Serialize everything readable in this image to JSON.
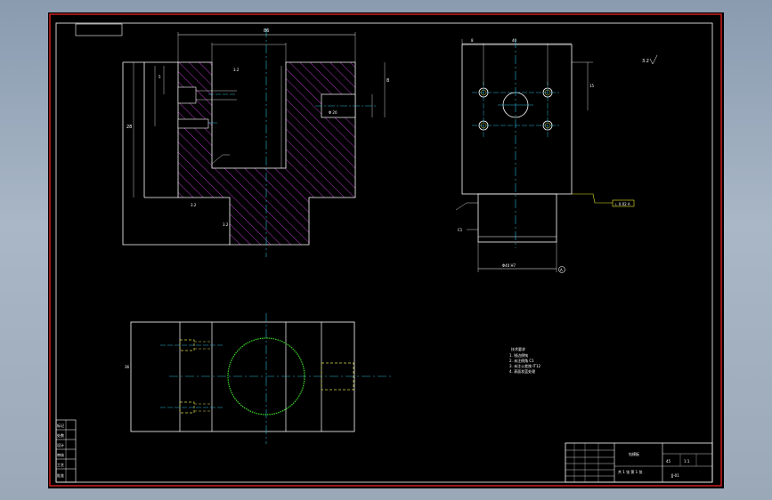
{
  "colors": {
    "background": "#000000",
    "border_red": "#cc1f1f",
    "outline": "#ffffff",
    "centerline": "#2ab7d6",
    "hatch": "#b234c4",
    "circle_green": "#3ddc2a",
    "leader_yellow": "#e6e62a",
    "hidden_line": "#d8d84a"
  },
  "front_view": {
    "dim_top": "86",
    "dim_left": "28",
    "dim_right": "8",
    "dim_inner": "5",
    "bore_note": "Φ 20",
    "roughness_a": "3.2",
    "roughness_b": "3.2",
    "roughness_c": "3.2"
  },
  "side_view": {
    "dim_top_left": "8",
    "dim_top_center": "40",
    "dim_right": "15",
    "roughness": "3.2",
    "tolerance_frame": "⊥ 0.02 A",
    "dim_bottom": "Φ40 H7",
    "datum": "A",
    "chamfer": "C1"
  },
  "top_view": {
    "dim_left": "36"
  },
  "general_roughness": "3.2",
  "notes": [
    "技术要求",
    "1. 锐边倒钝",
    "2. 未注倒角 C1",
    "3. 未注公差按 IT12",
    "4. 表面发蓝处理"
  ],
  "left_strip": [
    "标记",
    "处数",
    "设计",
    "审核",
    "工艺",
    "批准"
  ],
  "title_block": {
    "part_name": "钻模板",
    "material": "45",
    "scale": "1:1",
    "sheet": "共 1 张 第 1 张",
    "drawing_no": "JJ-01"
  }
}
